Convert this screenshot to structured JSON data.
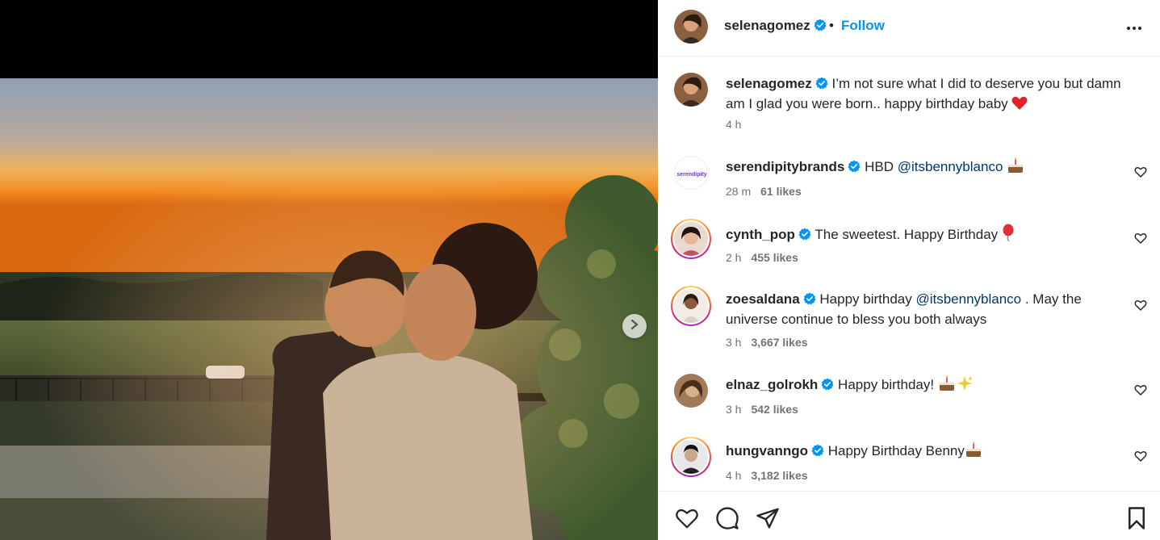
{
  "header": {
    "username": "selenagomez",
    "separator": "•",
    "follow_label": "Follow",
    "more_icon": "more-horizontal-icon"
  },
  "caption": {
    "username": "selenagomez",
    "text": "I’m not sure what I did to deserve you but damn am I glad you were born.. happy birthday baby",
    "emoji": "red-heart",
    "time": "4 h"
  },
  "comments": [
    {
      "username": "serendipitybrands",
      "pre": "HBD ",
      "mention": "@itsbennyblanco",
      "post": " ",
      "emoji": "birthday-cake",
      "time": "28 m",
      "likes": "61 likes",
      "avatar_text": "serendipity"
    },
    {
      "username": "cynth_pop",
      "pre": "The sweetest. Happy Birthday ",
      "mention": "",
      "post": "",
      "emoji": "balloon",
      "time": "2 h",
      "likes": "455 likes"
    },
    {
      "username": "zoesaldana",
      "pre": "Happy birthday ",
      "mention": "@itsbennyblanco",
      "post": " . May the universe continue to bless you both always",
      "emoji": "",
      "time": "3 h",
      "likes": "3,667 likes"
    },
    {
      "username": "elnaz_golrokh",
      "pre": "Happy birthday! ",
      "mention": "",
      "post": "",
      "emoji": "cake-sparkles",
      "time": "3 h",
      "likes": "542 likes"
    },
    {
      "username": "hungvanngo",
      "pre": "Happy Birthday Benny",
      "mention": "",
      "post": "",
      "emoji": "birthday-cake",
      "time": "4 h",
      "likes": "3,182 likes"
    }
  ],
  "actions": {
    "like_icon": "heart-icon",
    "comment_icon": "comment-icon",
    "share_icon": "share-icon",
    "save_icon": "bookmark-icon"
  },
  "colors": {
    "link_blue": "#0095f6",
    "mention_blue": "#00376b",
    "verified_blue": "#0095f6",
    "meta_gray": "#737373"
  }
}
